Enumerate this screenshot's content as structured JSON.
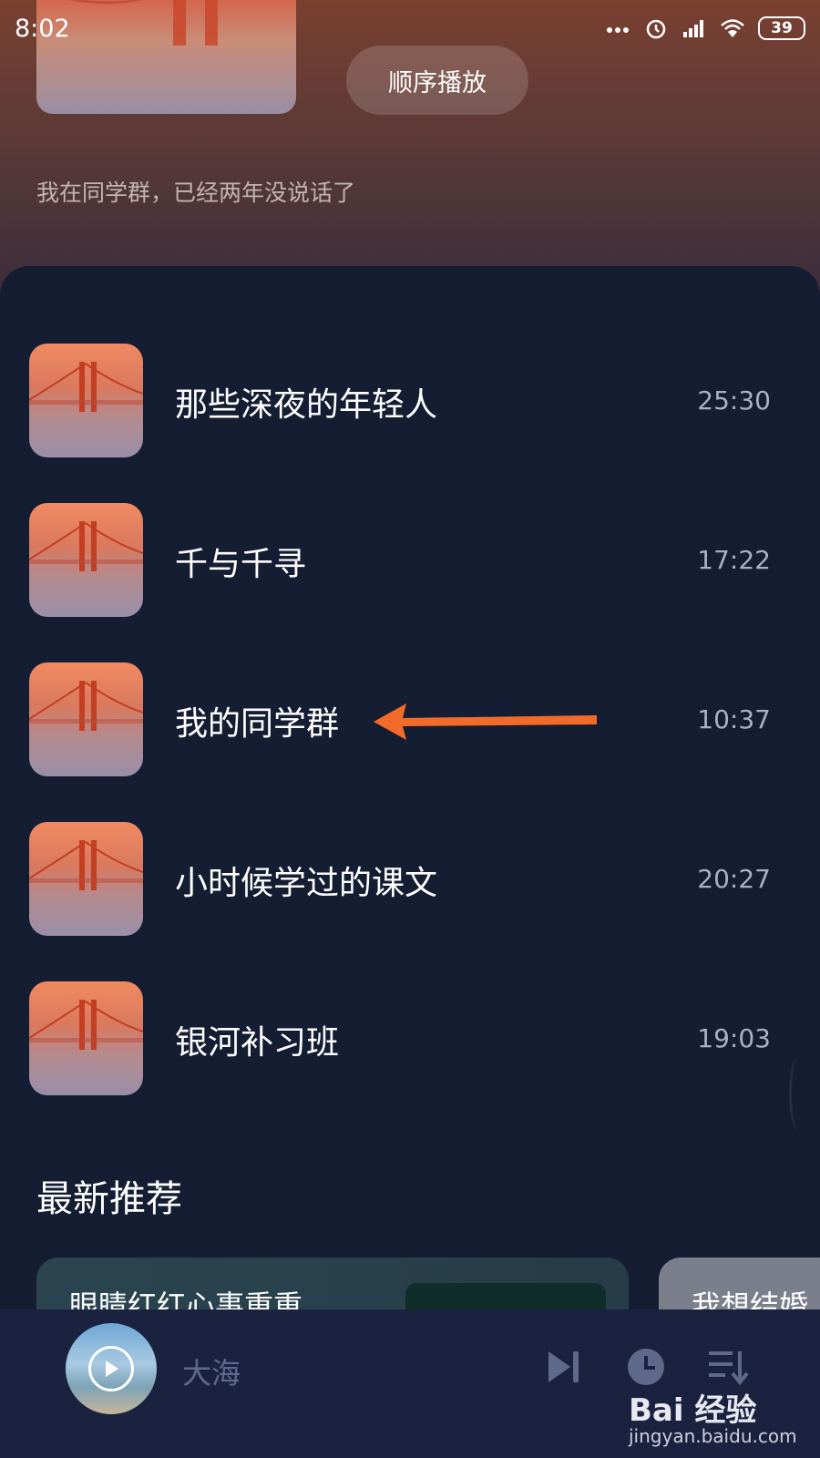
{
  "status_bar": {
    "time": "8:02",
    "battery": "39",
    "icons": [
      "more-dots-icon",
      "alarm-icon",
      "signal-icon",
      "wifi-icon",
      "battery-icon"
    ]
  },
  "header": {
    "play_order_label": "顺序播放",
    "description": "我在同学群，已经两年没说话了"
  },
  "episodes": [
    {
      "title": "那些深夜的年轻人",
      "duration": "25:30"
    },
    {
      "title": "千与千寻",
      "duration": "17:22"
    },
    {
      "title": "我的同学群",
      "duration": "10:37"
    },
    {
      "title": "小时候学过的课文",
      "duration": "20:27"
    },
    {
      "title": "银河补习班",
      "duration": "19:03"
    }
  ],
  "recommend": {
    "section_title": "最新推荐",
    "cards": [
      {
        "title": "眼睛红红心事重重"
      },
      {
        "title": "我想结婚"
      }
    ]
  },
  "player": {
    "title": "大海"
  },
  "watermark": {
    "logo": "Bai 经验",
    "url": "jingyan.baidu.com"
  },
  "colors": {
    "accent_arrow": "#f26b2a",
    "panel_bg": "#151d33",
    "player_bg": "#1a2240"
  }
}
